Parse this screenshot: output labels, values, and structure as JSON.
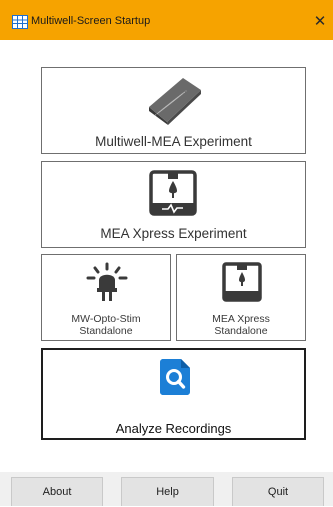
{
  "window": {
    "title": "Multiwell-Screen Startup",
    "close_glyph": "✕",
    "app_icon": "grid-table-icon"
  },
  "cards": {
    "multiwell": {
      "label": "Multiwell-MEA Experiment",
      "icon": "mea-plate-icon"
    },
    "xpress": {
      "label": "MEA Xpress Experiment",
      "icon": "mea-xpress-device-icon"
    },
    "opto": {
      "line1": "MW-Opto-Stim",
      "line2": "Standalone",
      "icon": "led-light-icon"
    },
    "xpress_standalone": {
      "line1": "MEA Xpress",
      "line2": "Standalone",
      "icon": "mea-xpress-device-icon"
    },
    "analyze": {
      "label": "Analyze Recordings",
      "icon": "magnifier-document-icon"
    }
  },
  "buttons": {
    "about": "About",
    "help": "Help",
    "quit": "Quit"
  },
  "colors": {
    "titlebar": "#f6a300",
    "analyze_icon": "#1c7fd6",
    "device_icon": "#3a3a3a"
  }
}
